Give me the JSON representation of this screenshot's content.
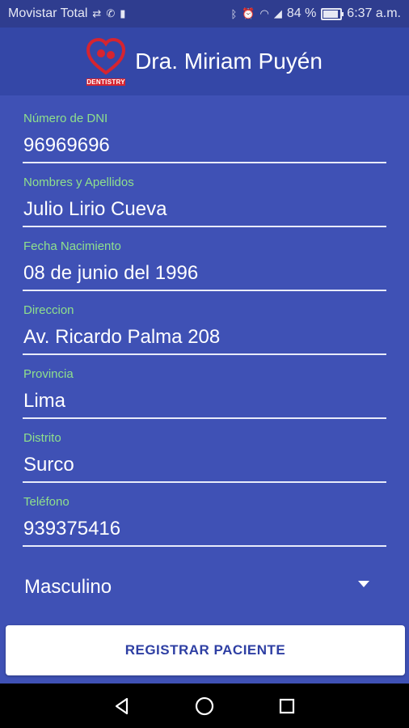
{
  "status_bar": {
    "carrier": "Movistar Total",
    "battery_percent": "84 %",
    "time": "6:37 a.m."
  },
  "app_bar": {
    "title": "Dra. Miriam Puyén",
    "logo_text": "DENTISTRY"
  },
  "form": {
    "fields": [
      {
        "label": "Número de DNI",
        "value": "96969696"
      },
      {
        "label": "Nombres y Apellidos",
        "value": "Julio Lirio Cueva"
      },
      {
        "label": "Fecha Nacimiento",
        "value": "08 de junio del 1996"
      },
      {
        "label": "Direccion",
        "value": "Av. Ricardo Palma 208"
      },
      {
        "label": "Provincia",
        "value": "Lima"
      },
      {
        "label": "Distrito",
        "value": "Surco"
      },
      {
        "label": "Teléfono",
        "value": "939375416"
      }
    ],
    "gender": "Masculino",
    "submit_label": "REGISTRAR PACIENTE"
  },
  "colors": {
    "primary": "#3f51b5",
    "label": "#8fe08c",
    "button_text": "#2e3fa3"
  },
  "icons": [
    "sim-icon",
    "whatsapp-icon",
    "sd-card-icon",
    "bluetooth-icon",
    "alarm-icon",
    "wifi-icon",
    "signal-icon",
    "battery-icon",
    "back-icon",
    "home-icon",
    "recents-icon"
  ]
}
